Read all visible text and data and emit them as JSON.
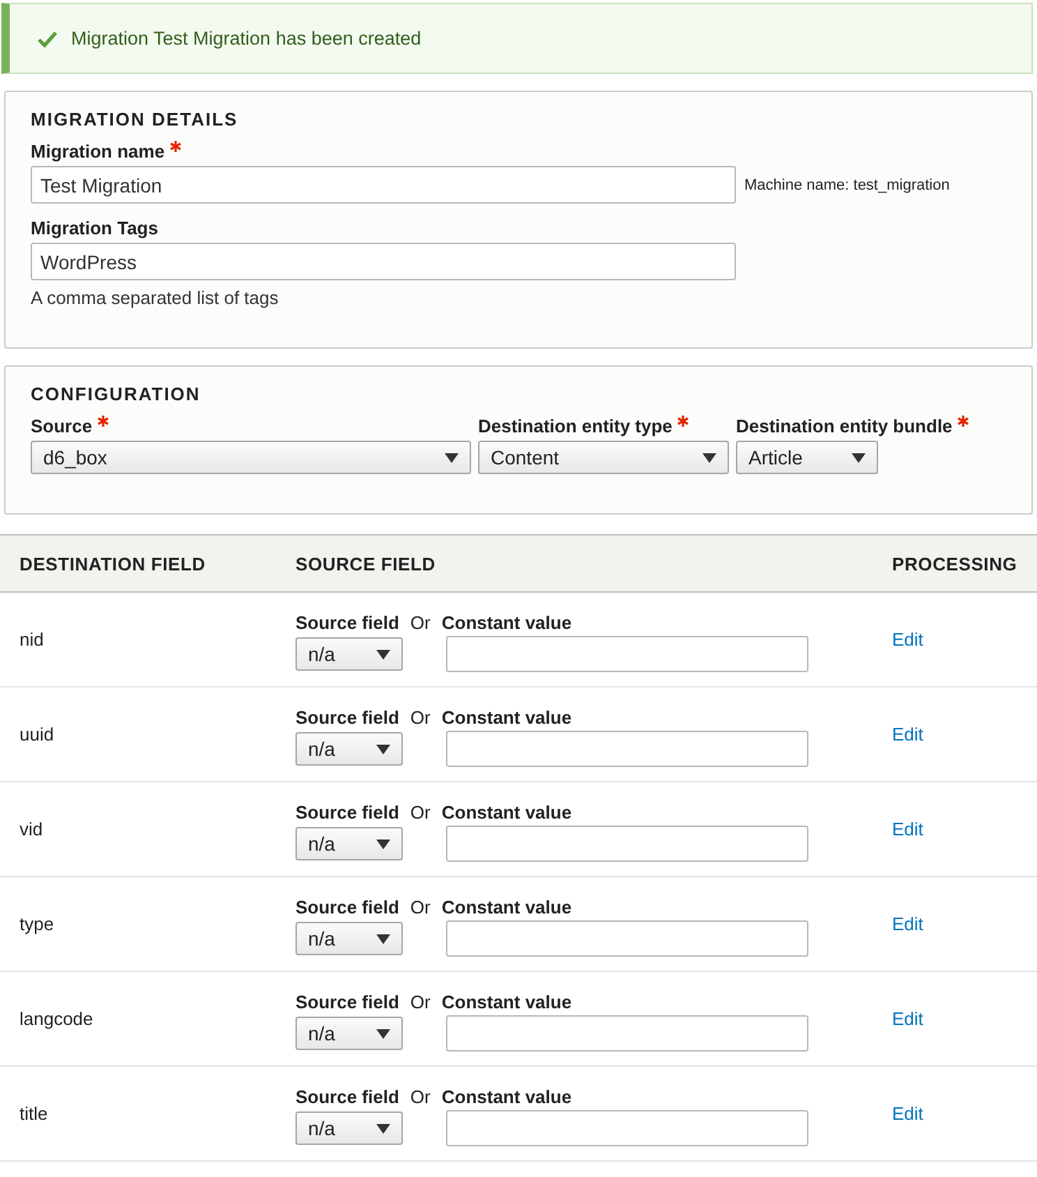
{
  "message": {
    "kind": "status",
    "text": "Migration Test Migration has been created"
  },
  "details": {
    "legend": "MIGRATION DETAILS",
    "name": {
      "label": "Migration name",
      "required": true,
      "value": "Test Migration",
      "machine_name": "Machine name: test_migration"
    },
    "tags": {
      "label": "Migration Tags",
      "value": "WordPress",
      "description": "A comma separated list of tags"
    }
  },
  "configuration": {
    "legend": "CONFIGURATION",
    "selects": [
      {
        "label": "Source",
        "required": true,
        "value": "d6_box"
      },
      {
        "label": "Destination entity type",
        "required": true,
        "value": "Content"
      },
      {
        "label": "Destination entity bundle",
        "required": true,
        "value": "Article"
      }
    ]
  },
  "table": {
    "columns": [
      "DESTINATION FIELD",
      "SOURCE FIELD",
      "PROCESSING"
    ],
    "rows": [
      {
        "destination": "nid",
        "source_label": "Source field",
        "or": "Or",
        "constant_label": "Constant value",
        "source_value": "n/a",
        "constant_value": "",
        "action": "Edit"
      },
      {
        "destination": "uuid",
        "source_label": "Source field",
        "or": "Or",
        "constant_label": "Constant value",
        "source_value": "n/a",
        "constant_value": "",
        "action": "Edit"
      },
      {
        "destination": "vid",
        "source_label": "Source field",
        "or": "Or",
        "constant_label": "Constant value",
        "source_value": "n/a",
        "constant_value": "",
        "action": "Edit"
      },
      {
        "destination": "type",
        "source_label": "Source field",
        "or": "Or",
        "constant_label": "Constant value",
        "source_value": "n/a",
        "constant_value": "",
        "action": "Edit"
      },
      {
        "destination": "langcode",
        "source_label": "Source field",
        "or": "Or",
        "constant_label": "Constant value",
        "source_value": "n/a",
        "constant_value": "",
        "action": "Edit"
      },
      {
        "destination": "title",
        "source_label": "Source field",
        "or": "Or",
        "constant_label": "Constant value",
        "source_value": "n/a",
        "constant_value": "",
        "action": "Edit"
      }
    ]
  }
}
